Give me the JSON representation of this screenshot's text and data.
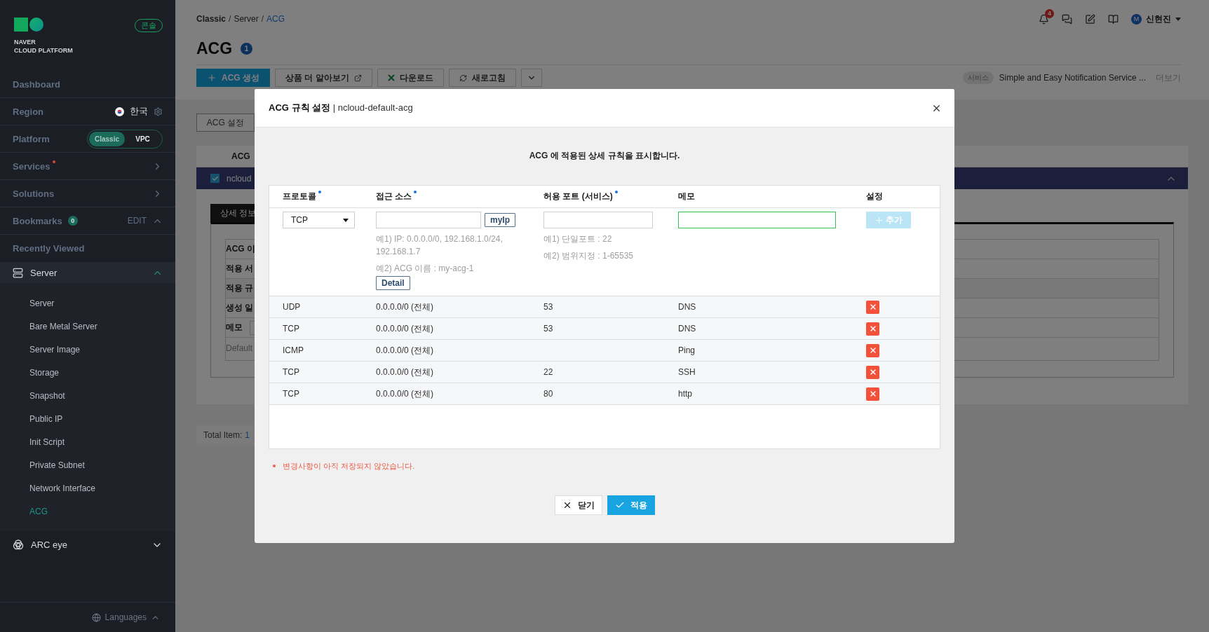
{
  "sidebar": {
    "logo": {
      "line1": "NAVER",
      "line2": "CLOUD PLATFORM"
    },
    "console_badge": "콘솔",
    "nav": [
      {
        "kind": "link",
        "label": "Dashboard"
      },
      {
        "kind": "region",
        "label": "Region",
        "value": "한국"
      },
      {
        "kind": "platform",
        "label": "Platform",
        "options": [
          {
            "label": "Classic",
            "selected": true
          },
          {
            "label": "VPC",
            "selected": false
          }
        ]
      },
      {
        "kind": "menu",
        "label": "Services",
        "new": true
      },
      {
        "kind": "menu",
        "label": "Solutions",
        "new": false
      },
      {
        "kind": "bookmarks",
        "label": "Bookmarks",
        "count": "0",
        "action": "EDIT",
        "expanded": true
      },
      {
        "kind": "link",
        "label": "Recently Viewed"
      }
    ],
    "groups": [
      {
        "label": "Server",
        "expanded": true,
        "children": [
          {
            "label": "Server",
            "selected": false
          },
          {
            "label": "Bare Metal Server",
            "selected": false
          },
          {
            "label": "Server Image",
            "selected": false
          },
          {
            "label": "Storage",
            "selected": false
          },
          {
            "label": "Snapshot",
            "selected": false
          },
          {
            "label": "Public IP",
            "selected": false
          },
          {
            "label": "Init Script",
            "selected": false
          },
          {
            "label": "Private Subnet",
            "selected": false
          },
          {
            "label": "Network Interface",
            "selected": false
          },
          {
            "label": "ACG",
            "selected": true
          }
        ]
      },
      {
        "label": "ARC eye",
        "expanded": false
      }
    ],
    "languages": "Languages"
  },
  "header": {
    "breadcrumb": [
      {
        "label": "Classic",
        "separator": "/",
        "current": false
      },
      {
        "label": "Server",
        "separator": "/",
        "current": false
      },
      {
        "label": "ACG",
        "current": true
      }
    ],
    "notifications": "4",
    "user": {
      "initial": "M",
      "name": "신현진"
    }
  },
  "page": {
    "title": "ACG",
    "count": "1",
    "toolbar": [
      {
        "kind": "primary",
        "label": "ACG 생성"
      },
      {
        "kind": "external",
        "label": "상품 더 알아보기"
      },
      {
        "kind": "download",
        "label": "다운로드"
      },
      {
        "kind": "refresh",
        "label": "새로고침"
      },
      {
        "kind": "more"
      }
    ],
    "promo": {
      "tag": "서비스",
      "text": "Simple and Easy Notification Service ...",
      "more": "더보기"
    },
    "tabs": [
      {
        "label": "ACG 설정",
        "selected": false
      }
    ],
    "list": {
      "header": "ACG",
      "rows": [
        {
          "name": "ncloud",
          "checked": true,
          "expanded": true
        }
      ]
    },
    "detail": {
      "tab": "상세 정보",
      "fields": [
        "ACG 이",
        "적용 서",
        "적용 규",
        "생성 일",
        "메모"
      ],
      "note": "Default"
    },
    "total": {
      "label": "Total Item:",
      "value": "1"
    }
  },
  "modal": {
    "title": "ACG 규칙 설정",
    "subtitle": "| ncloud-default-acg",
    "description": "ACG 에 적용된 상세 규칙을 표시합니다.",
    "columns": [
      {
        "label": "프로토콜",
        "required": true
      },
      {
        "label": "접근 소스",
        "required": true
      },
      {
        "label": "허용 포트 (서비스)",
        "required": true
      },
      {
        "label": "메모",
        "required": false
      },
      {
        "label": "설정",
        "required": false
      }
    ],
    "new_rule": {
      "protocol": "TCP",
      "myip": "myIp",
      "source_hints": [
        "예1) IP: 0.0.0.0/0, 192.168.1.0/24, 192.168.1.7",
        "예2) ACG 이름 : my-acg-1"
      ],
      "detail": "Detail",
      "port_hints": [
        "예1) 단일포트 : 22",
        "예2) 범위지정 : 1-65535"
      ],
      "memo_focused": true,
      "add": "추가",
      "add_disabled": true
    },
    "rules": [
      {
        "protocol": "UDP",
        "source": "0.0.0.0/0 (전체)",
        "port": "53",
        "memo": "DNS"
      },
      {
        "protocol": "TCP",
        "source": "0.0.0.0/0 (전체)",
        "port": "53",
        "memo": "DNS"
      },
      {
        "protocol": "ICMP",
        "source": "0.0.0.0/0 (전체)",
        "memo": "Ping"
      },
      {
        "protocol": "TCP",
        "source": "0.0.0.0/0 (전체)",
        "port": "22",
        "memo": "SSH"
      },
      {
        "protocol": "TCP",
        "source": "0.0.0.0/0 (전체)",
        "port": "80",
        "memo": "http"
      }
    ],
    "warning": "변경사항이 아직 저장되지 않았습니다.",
    "buttons": [
      {
        "kind": "close",
        "label": "닫기"
      },
      {
        "kind": "apply",
        "label": "적용"
      }
    ]
  }
}
